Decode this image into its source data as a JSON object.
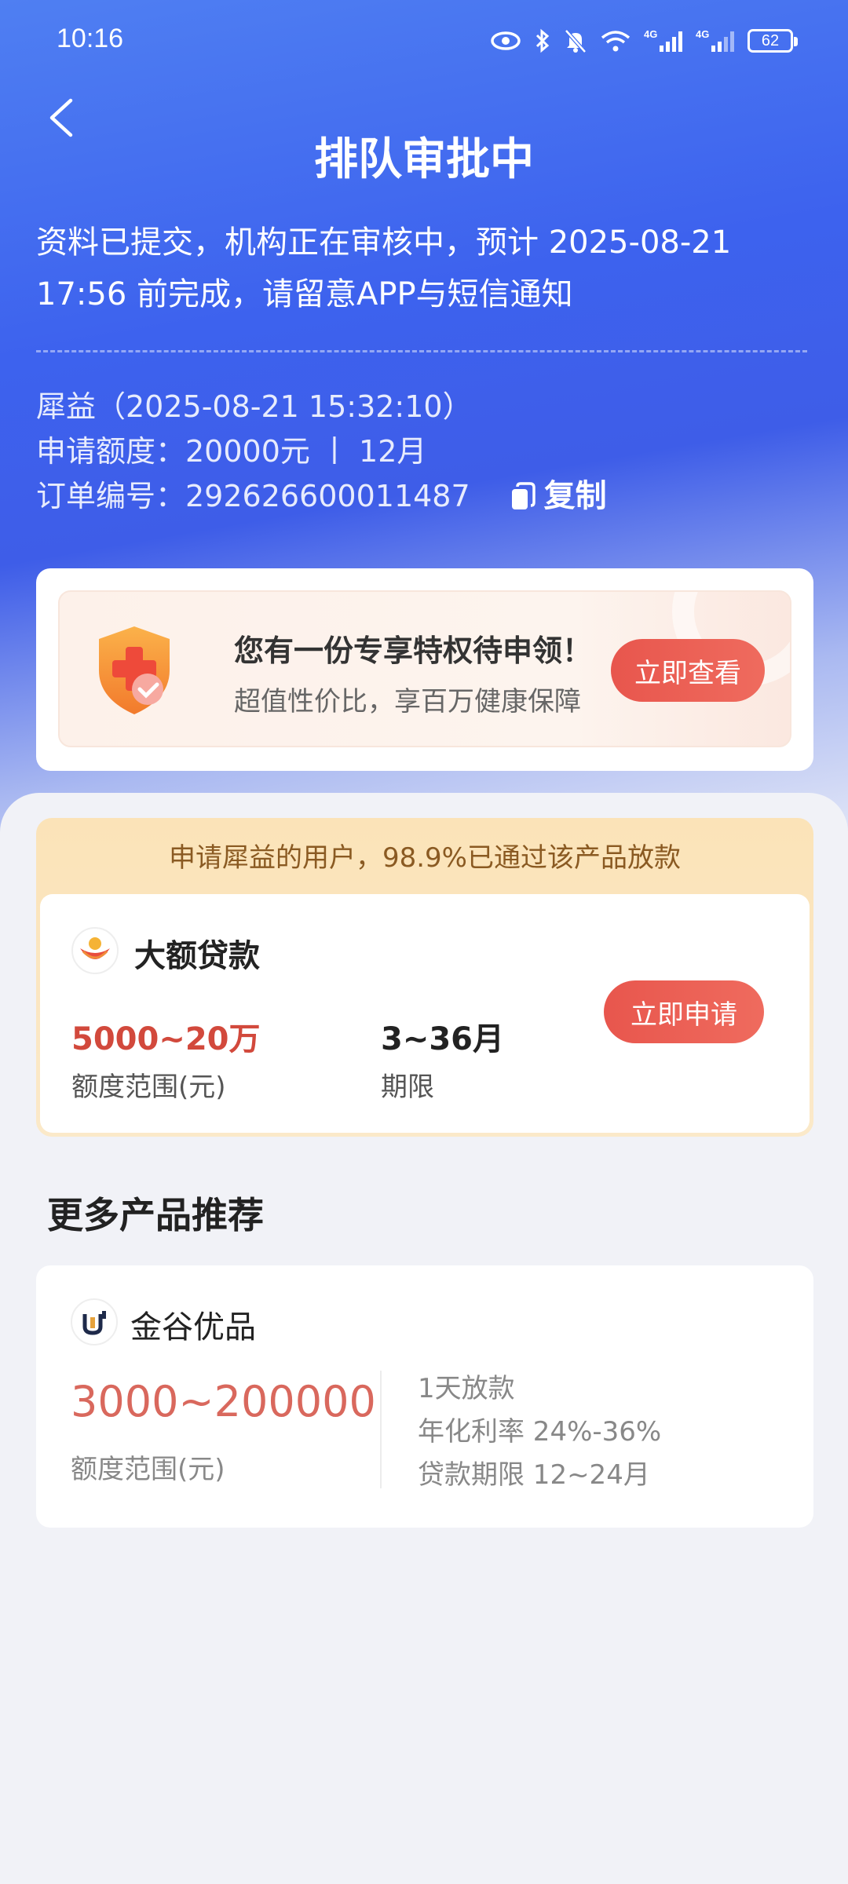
{
  "status_bar": {
    "time": "10:16",
    "battery": "62"
  },
  "header": {
    "title": "排队审批中",
    "description": "资料已提交，机构正在审核中，预计 2025-08-21 17:56 前完成，请留意APP与短信通知"
  },
  "order": {
    "institution_line": "犀益（2025-08-21 15:32:10）",
    "amount_line": "申请额度：20000元 丨 12月",
    "order_no_line": "订单编号：292626600011487",
    "copy_label": "复制"
  },
  "privilege": {
    "title": "您有一份专享特权待申领！",
    "subtitle": "超值性价比，享百万健康保障",
    "button": "立即查看"
  },
  "promo": {
    "banner": "申请犀益的用户，98.9%已通过该产品放款",
    "product_name": "大额贷款",
    "amount": "5000~20万",
    "amount_label": "额度范围(元)",
    "term": "3~36月",
    "term_label": "期限",
    "button": "立即申请"
  },
  "more": {
    "title": "更多产品推荐",
    "product_name": "金谷优品",
    "amount": "3000~200000",
    "amount_label": "额度范围(元)",
    "details": [
      "1天放款",
      "年化利率 24%-36%",
      "贷款期限 12~24月"
    ]
  },
  "colors": {
    "header_blue": "#3d62ee",
    "accent_red": "#e8564d",
    "amount_red": "#d2493c",
    "banner_gold": "#fbe3b8"
  }
}
